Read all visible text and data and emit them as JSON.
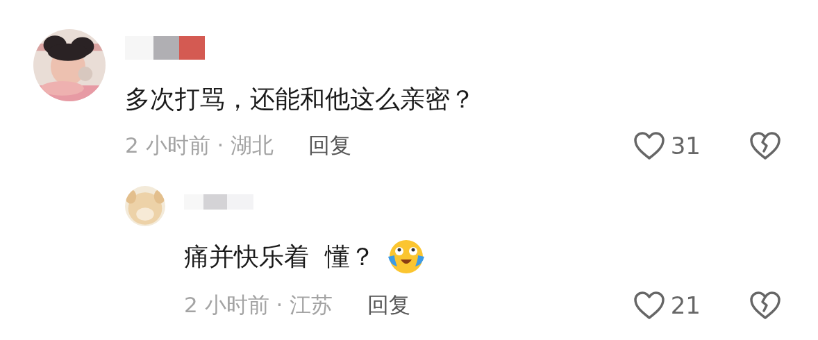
{
  "comments": [
    {
      "text": "多次打骂，还能和他这么亲密？",
      "meta": "2 小时前 · 湖北",
      "reply_label": "回复",
      "liked": false,
      "like_count": "31",
      "replies": [
        {
          "text": "痛并快乐着  懂？",
          "emoji": true,
          "meta": "2 小时前 · 江苏",
          "reply_label": "回复",
          "liked": false,
          "like_count": "21"
        }
      ]
    }
  ]
}
